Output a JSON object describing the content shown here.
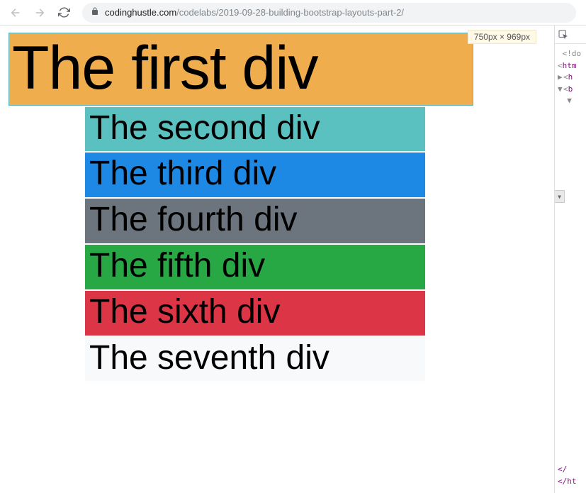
{
  "toolbar": {
    "url_domain": "codinghustle.com",
    "url_path": "/codelabs/2019-09-28-building-bootstrap-layouts-part-2/"
  },
  "viewport": {
    "dimensions": "750px × 969px"
  },
  "divs": [
    {
      "text": "The first div",
      "class": "first-div"
    },
    {
      "text": "The second div",
      "class": "other-row bg-teal"
    },
    {
      "text": "The third div",
      "class": "other-row bg-blue"
    },
    {
      "text": "The fourth div",
      "class": "other-row bg-gray"
    },
    {
      "text": "The fifth div",
      "class": "other-row bg-green"
    },
    {
      "text": "The sixth div",
      "class": "other-row bg-red"
    },
    {
      "text": "The seventh div",
      "class": "other-row bg-white"
    }
  ],
  "devtools": {
    "line1": "<!do",
    "line2": "htm",
    "line3": "h",
    "line4": "b",
    "close1": "</",
    "close2": "</ht",
    "expand": "…"
  }
}
